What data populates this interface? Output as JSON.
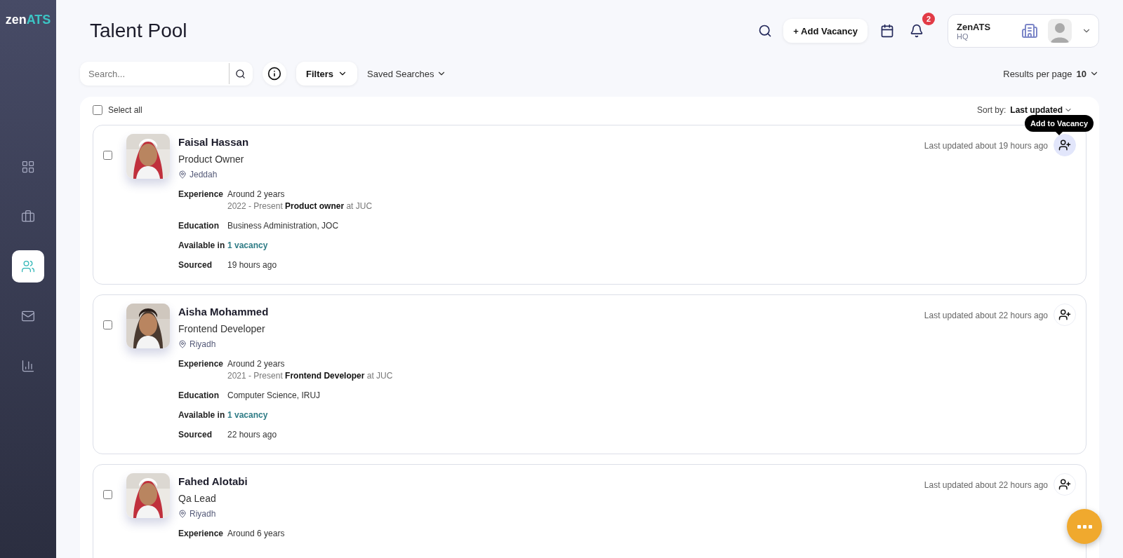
{
  "sidebar": {
    "logo": {
      "main": "zen",
      "accent": "ATS"
    },
    "items": [
      {
        "kind": "grid",
        "selected": false
      },
      {
        "kind": "briefcase",
        "selected": false
      },
      {
        "kind": "people",
        "selected": true
      },
      {
        "kind": "mail",
        "selected": false
      },
      {
        "kind": "chart",
        "selected": false
      }
    ]
  },
  "header": {
    "title": "Talent Pool",
    "add_button": "+ Add Vacancy",
    "notification_count": "2",
    "account": {
      "name": "ZenATS",
      "branch": "HQ"
    }
  },
  "toolbar": {
    "search": {
      "placeholder": "Search..."
    },
    "filters": "Filters",
    "saved_searches": "Saved Searches",
    "results_label": "Results per page",
    "results_value": "10"
  },
  "list": {
    "select_all": {
      "label": "Select all",
      "checked": false
    },
    "sort_label": "Sort by:",
    "sort_value": "Last updated",
    "tooltip": "Add to Vacancy",
    "candidates": [
      {
        "name": "Faisal Hassan",
        "title": "Product Owner",
        "location": "Jeddah",
        "checked": false,
        "updated": "Last updated about 19 hours ago",
        "hovered": true,
        "details": [
          {
            "label": "Experience",
            "lines": [
              "Around 2 years",
              "2022 - Present **Product owner** at JUC"
            ]
          },
          {
            "label": "Education",
            "lines": [
              "Business Administration, JOC"
            ]
          },
          {
            "label": "Available in",
            "lines": [
              "1 vacancy"
            ],
            "kind": "link"
          },
          {
            "label": "Sourced",
            "lines": [
              "19 hours ago"
            ]
          }
        ]
      },
      {
        "name": "Aisha Mohammed",
        "title": "Frontend Developer",
        "location": "Riyadh",
        "checked": false,
        "updated": "Last updated about 22 hours ago",
        "hovered": false,
        "details": [
          {
            "label": "Experience",
            "lines": [
              "Around 2 years",
              "2021 - Present **Frontend Developer** at JUC"
            ]
          },
          {
            "label": "Education",
            "lines": [
              "Computer Science, IRUJ"
            ]
          },
          {
            "label": "Available in",
            "lines": [
              "1 vacancy"
            ],
            "kind": "link"
          },
          {
            "label": "Sourced",
            "lines": [
              "22 hours ago"
            ]
          }
        ]
      },
      {
        "name": "Fahed Alotabi",
        "title": "Qa Lead",
        "location": "Riyadh",
        "checked": false,
        "updated": "Last updated about 22 hours ago",
        "hovered": false,
        "details": [
          {
            "label": "Experience",
            "lines": [
              "Around 6 years"
            ]
          }
        ]
      }
    ]
  }
}
